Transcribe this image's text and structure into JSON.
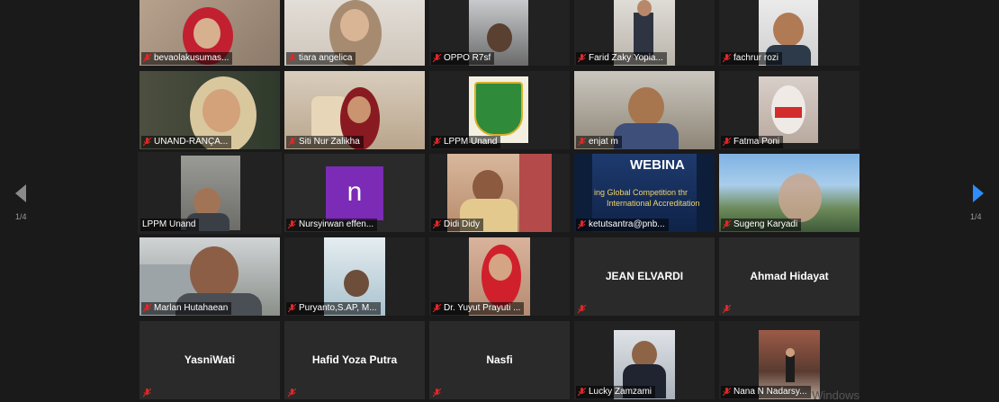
{
  "navigation": {
    "prev_page_indicator": "1/4",
    "next_page_indicator": "1/4"
  },
  "participants": [
    {
      "name": "bevaolakusumas...",
      "muted": true,
      "video": true
    },
    {
      "name": "tiara angelica",
      "muted": true,
      "video": true
    },
    {
      "name": "OPPO R7sf",
      "muted": true,
      "video": true
    },
    {
      "name": "Farid Zaky Yopia...",
      "muted": true,
      "video": true
    },
    {
      "name": "fachrur rozi",
      "muted": true,
      "video": true
    },
    {
      "name": "UNAND-RANÇA...",
      "muted": true,
      "video": true
    },
    {
      "name": "Siti Nur Zalikha",
      "muted": true,
      "video": true
    },
    {
      "name": "LPPM Unand",
      "muted": true,
      "video": true
    },
    {
      "name": "enjat m",
      "muted": true,
      "video": true
    },
    {
      "name": "Fatma Poni",
      "muted": true,
      "video": true
    },
    {
      "name": "LPPM Unand",
      "muted": false,
      "video": true,
      "active_speaker": true
    },
    {
      "name": "Nursyirwan effen...",
      "muted": true,
      "video": false,
      "avatar_letter": "n"
    },
    {
      "name": "Didi Didy",
      "muted": true,
      "video": true
    },
    {
      "name": "ketutsantra@pnb...",
      "muted": true,
      "video": true,
      "video_text": [
        "WEBINA",
        "ing Global Competition thr",
        "International Accreditation"
      ]
    },
    {
      "name": "Sugeng Karyadi",
      "muted": true,
      "video": true
    },
    {
      "name": "Marlan Hutahaean",
      "muted": true,
      "video": true
    },
    {
      "name": "Puryanto,S.AP, M...",
      "muted": true,
      "video": true
    },
    {
      "name": "Dr. Yuyut Prayuti ...",
      "muted": true,
      "video": true
    },
    {
      "name": "JEAN ELVARDI",
      "muted": true,
      "video": false
    },
    {
      "name": "Ahmad Hidayat",
      "muted": true,
      "video": false
    },
    {
      "name": "YasniWati",
      "muted": true,
      "video": false
    },
    {
      "name": "Hafid Yoza Putra",
      "muted": true,
      "video": false
    },
    {
      "name": "Nasfi",
      "muted": true,
      "video": false
    },
    {
      "name": "Lucky Zamzami",
      "muted": true,
      "video": true
    },
    {
      "name": "Nana N Nadarsy...",
      "muted": true,
      "video": true
    }
  ],
  "colors": {
    "background": "#1a1a1a",
    "active_border": "#c9d94a",
    "mute_icon": "#e02828",
    "next_arrow": "#2d8cff"
  },
  "watermark": "Windows"
}
